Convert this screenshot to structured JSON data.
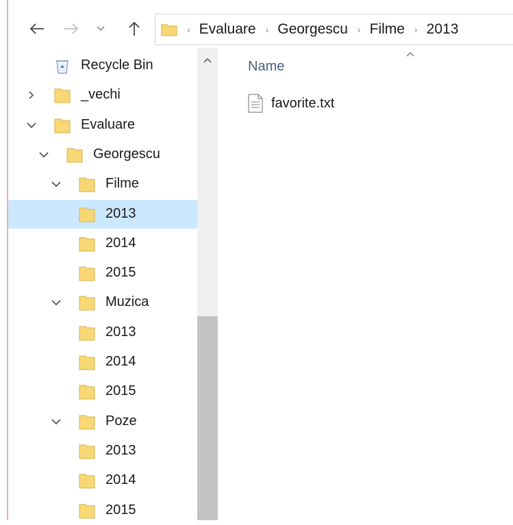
{
  "address_bar": {
    "breadcrumbs": [
      "Evaluare",
      "Georgescu",
      "Filme",
      "2013"
    ]
  },
  "navigation_pane": {
    "items": [
      {
        "label": "Recycle Bin",
        "icon": "recycle-bin-icon",
        "depth": 0,
        "expander": "none"
      },
      {
        "label": "_vechi",
        "icon": "folder-icon",
        "depth": 0,
        "expander": "collapsed"
      },
      {
        "label": "Evaluare",
        "icon": "folder-icon",
        "depth": 0,
        "expander": "expanded"
      },
      {
        "label": "Georgescu",
        "icon": "folder-icon",
        "depth": 1,
        "expander": "expanded"
      },
      {
        "label": "Filme",
        "icon": "folder-icon",
        "depth": 2,
        "expander": "expanded"
      },
      {
        "label": "2013",
        "icon": "folder-icon",
        "depth": 3,
        "expander": "none",
        "selected": true
      },
      {
        "label": "2014",
        "icon": "folder-icon",
        "depth": 3,
        "expander": "none"
      },
      {
        "label": "2015",
        "icon": "folder-icon",
        "depth": 3,
        "expander": "none"
      },
      {
        "label": "Muzica",
        "icon": "folder-icon",
        "depth": 2,
        "expander": "expanded"
      },
      {
        "label": "2013",
        "icon": "folder-icon",
        "depth": 3,
        "expander": "none"
      },
      {
        "label": "2014",
        "icon": "folder-icon",
        "depth": 3,
        "expander": "none"
      },
      {
        "label": "2015",
        "icon": "folder-icon",
        "depth": 3,
        "expander": "none"
      },
      {
        "label": "Poze",
        "icon": "folder-icon",
        "depth": 2,
        "expander": "expanded"
      },
      {
        "label": "2013",
        "icon": "folder-icon",
        "depth": 3,
        "expander": "none"
      },
      {
        "label": "2014",
        "icon": "folder-icon",
        "depth": 3,
        "expander": "none"
      },
      {
        "label": "2015",
        "icon": "folder-icon",
        "depth": 3,
        "expander": "none"
      }
    ]
  },
  "content": {
    "column_header": "Name",
    "files": [
      {
        "name": "favorite.txt",
        "icon": "text-file-icon"
      }
    ]
  },
  "colors": {
    "selection": "#cce8ff",
    "folder": "#f8d775",
    "column_header": "#4b5f7b"
  }
}
